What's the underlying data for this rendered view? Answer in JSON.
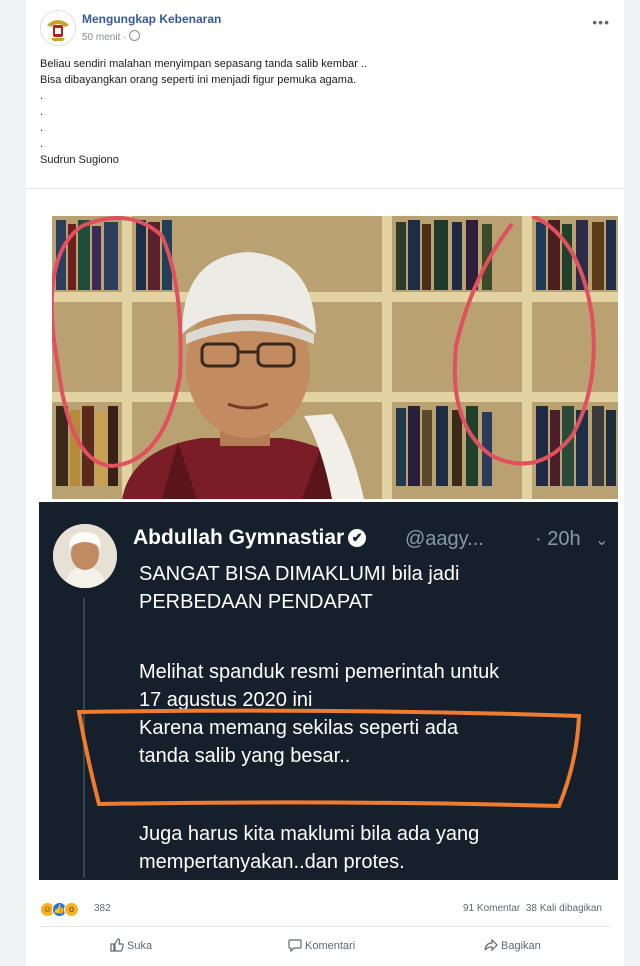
{
  "post": {
    "page_name": "Mengungkap Kebenaran",
    "time": "50 menit ·",
    "text_lines": [
      "Beliau sendiri malahan menyimpan sepasang tanda salib kembar ..",
      "Bisa dibayangkan orang seperti ini menjadi figur pemuka agama.",
      ".",
      ".",
      ".",
      ".",
      "Sudrun Sugiono"
    ]
  },
  "tweet": {
    "name": "Abdullah Gymnastiar",
    "handle": "@aagy...",
    "time": "· 20h",
    "body_lines": [
      "SANGAT BISA DIMAKLUMI bila jadi",
      "PERBEDAAN PENDAPAT",
      "Melihat spanduk resmi pemerintah untuk",
      "17 agustus 2020 ini",
      "Karena memang sekilas seperti ada",
      "tanda salib yang besar..",
      "Juga harus kita maklumi bila ada yang",
      "mempertanyakan..dan protes."
    ]
  },
  "stats": {
    "reactions_count": "382",
    "comments": "91 Komentar",
    "shares": "38 Kali dibagikan"
  },
  "actions": {
    "like": "Suka",
    "comment": "Komentari",
    "share": "Bagikan"
  },
  "colors": {
    "annotation_red": "#e0505f",
    "annotation_orange": "#ef7b2e",
    "tweet_bg": "#16202c",
    "link": "#385898"
  }
}
